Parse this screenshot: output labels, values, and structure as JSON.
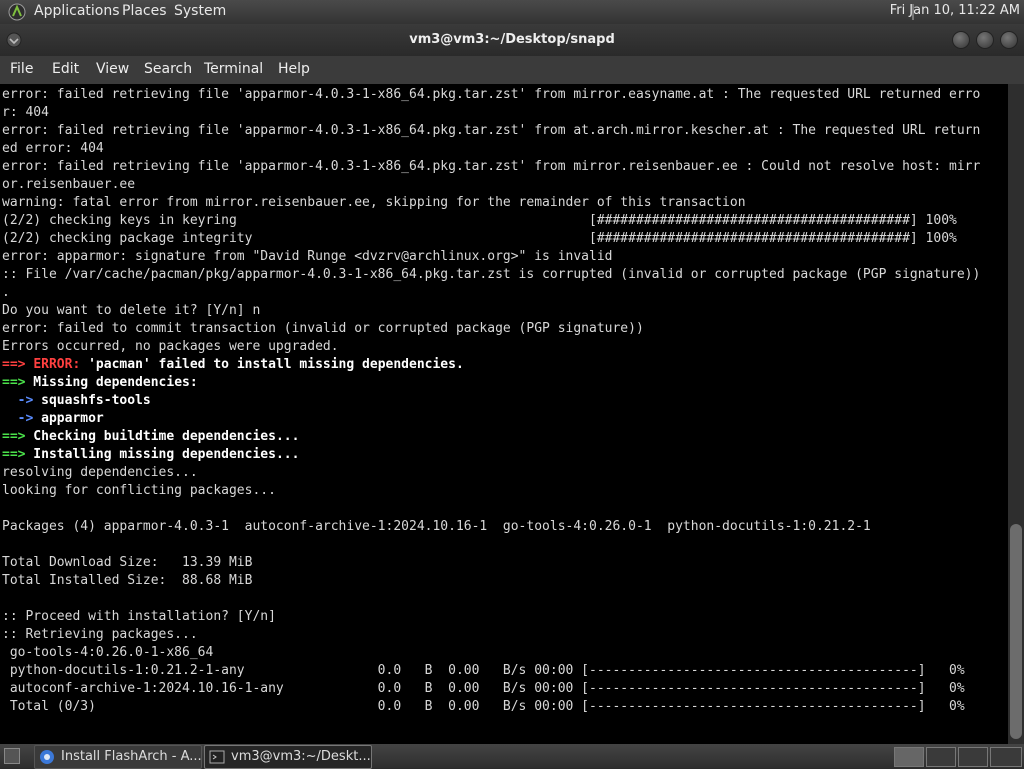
{
  "top_panel": {
    "menus": [
      "Applications",
      "Places",
      "System"
    ],
    "clock": "Fri Jan 10, 11:22 AM"
  },
  "window": {
    "title": "vm3@vm3:~/Desktop/snapd",
    "menu": [
      "File",
      "Edit",
      "View",
      "Search",
      "Terminal",
      "Help"
    ]
  },
  "terminal": {
    "lines": [
      "error: failed retrieving file 'apparmor-4.0.3-1-x86_64.pkg.tar.zst' from mirror.easyname.at : The requested URL returned erro",
      "r: 404",
      "error: failed retrieving file 'apparmor-4.0.3-1-x86_64.pkg.tar.zst' from at.arch.mirror.kescher.at : The requested URL return",
      "ed error: 404",
      "error: failed retrieving file 'apparmor-4.0.3-1-x86_64.pkg.tar.zst' from mirror.reisenbauer.ee : Could not resolve host: mirr",
      "or.reisenbauer.ee",
      "warning: fatal error from mirror.reisenbauer.ee, skipping for the remainder of this transaction",
      "(2/2) checking keys in keyring                                             [########################################] 100%",
      "(2/2) checking package integrity                                           [########################################] 100%",
      "error: apparmor: signature from \"David Runge <dvzrv@archlinux.org>\" is invalid",
      ":: File /var/cache/pacman/pkg/apparmor-4.0.3-1-x86_64.pkg.tar.zst is corrupted (invalid or corrupted package (PGP signature))",
      ".",
      "Do you want to delete it? [Y/n] n",
      "error: failed to commit transaction (invalid or corrupted package (PGP signature))",
      "Errors occurred, no packages were upgraded."
    ],
    "error_line": {
      "arrow": "==>",
      "label": "ERROR:",
      "text": " 'pacman' failed to install missing dependencies."
    },
    "missing_header": {
      "arrow": "==>",
      "text": " Missing dependencies:"
    },
    "missing_items": [
      {
        "arrow": "  ->",
        "text": " squashfs-tools"
      },
      {
        "arrow": "  ->",
        "text": " apparmor"
      }
    ],
    "checking_line": {
      "arrow": "==>",
      "text": " Checking buildtime dependencies..."
    },
    "installing_line": {
      "arrow": "==>",
      "text": " Installing missing dependencies..."
    },
    "tail_lines": [
      "resolving dependencies...",
      "looking for conflicting packages...",
      "",
      "Packages (4) apparmor-4.0.3-1  autoconf-archive-1:2024.10.16-1  go-tools-4:0.26.0-1  python-docutils-1:0.21.2-1",
      "",
      "Total Download Size:   13.39 MiB",
      "Total Installed Size:  88.68 MiB",
      "",
      ":: Proceed with installation? [Y/n]",
      ":: Retrieving packages...",
      " go-tools-4:0.26.0-1-x86_64",
      " python-docutils-1:0.21.2-1-any                 0.0   B  0.00   B/s 00:00 [------------------------------------------]   0%",
      " autoconf-archive-1:2024.10.16-1-any            0.0   B  0.00   B/s 00:00 [------------------------------------------]   0%",
      " Total (0/3)                                    0.0   B  0.00   B/s 00:00 [------------------------------------------]   0%"
    ]
  },
  "taskbar": {
    "tasks": [
      {
        "label": "Install FlashArch - A...",
        "icon": "browser-icon",
        "active": false
      },
      {
        "label": "vm3@vm3:~/Deskt...",
        "icon": "terminal-icon",
        "active": true
      }
    ]
  },
  "colors": {
    "arrow_green": "#4be34b",
    "error_red": "#ff4040",
    "arrow_blue": "#5a8cff",
    "terminal_bg": "#000000",
    "terminal_fg": "#d8d8d8"
  }
}
